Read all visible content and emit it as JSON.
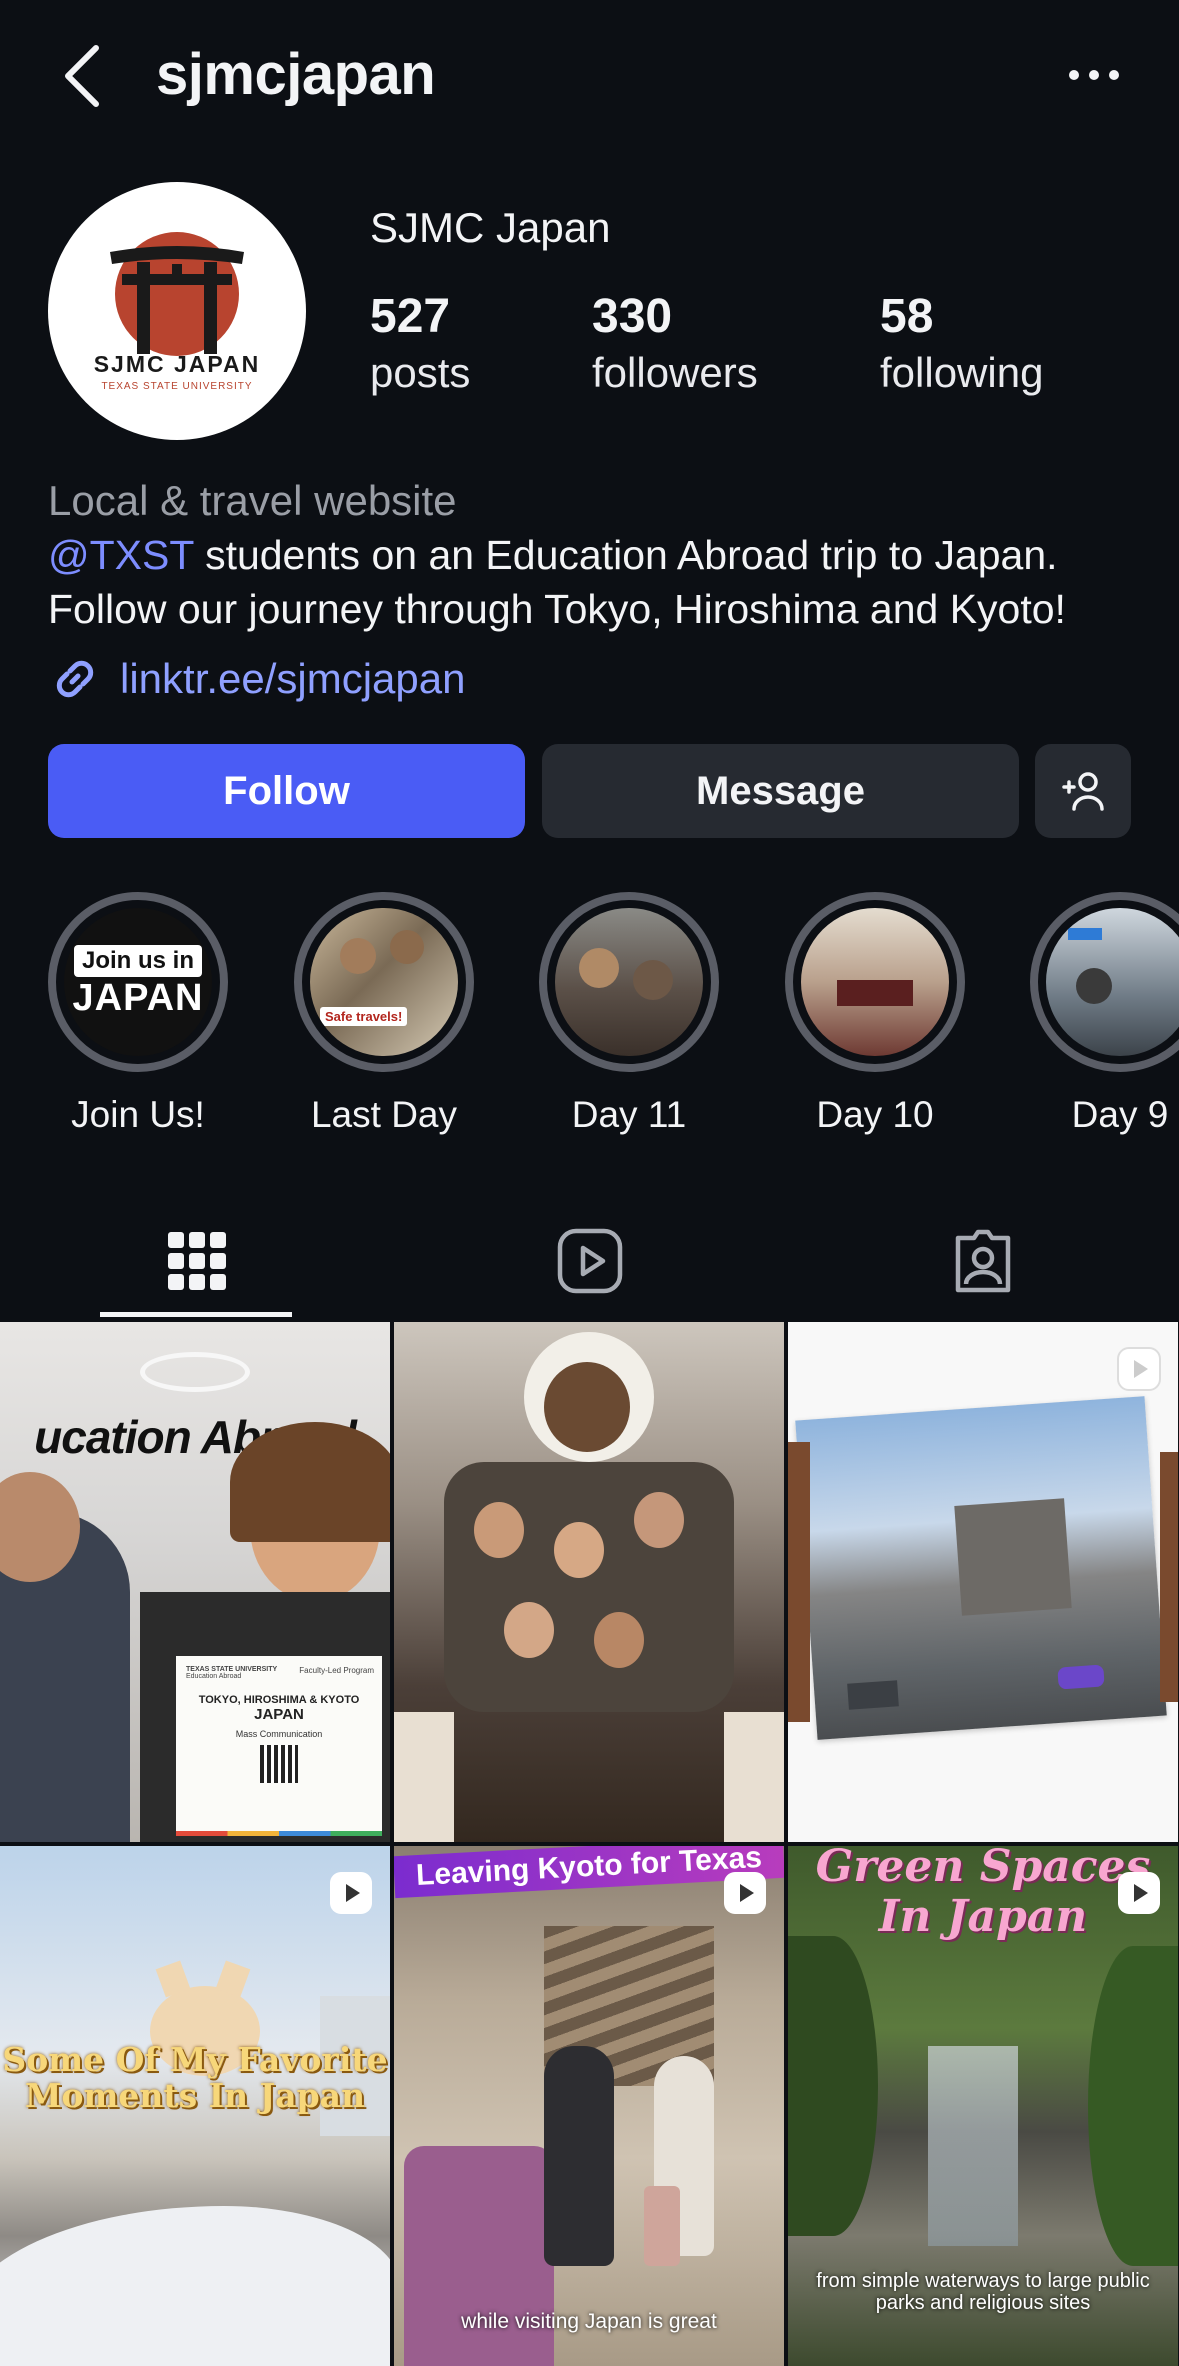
{
  "header": {
    "username": "sjmcjapan",
    "back_icon": "chevron-left-icon",
    "more_icon": "more-horizontal-icon"
  },
  "profile": {
    "display_name": "SJMC Japan",
    "avatar_text_main": "SJMC JAPAN",
    "avatar_text_sub": "TEXAS STATE UNIVERSITY",
    "stats": [
      {
        "value": "527",
        "label": "posts"
      },
      {
        "value": "330",
        "label": "followers"
      },
      {
        "value": "58",
        "label": "following"
      }
    ],
    "category": "Local & travel website",
    "bio_mention": "@TXST",
    "bio_text": " students on an Education Abroad trip to Japan. Follow our journey through Tokyo, Hiroshima and Kyoto!",
    "link": "linktr.ee/sjmcjapan"
  },
  "actions": {
    "follow_label": "Follow",
    "message_label": "Message",
    "add_user_icon": "add-user-icon"
  },
  "highlights": [
    {
      "label": "Join Us!",
      "pic_text_1": "Join us in",
      "pic_text_2": "JAPAN"
    },
    {
      "label": "Last Day",
      "pic_text_1": "Safe travels!"
    },
    {
      "label": "Day 11"
    },
    {
      "label": "Day 10"
    },
    {
      "label": "Day 9"
    }
  ],
  "tabs": [
    {
      "icon": "grid-icon",
      "active": true
    },
    {
      "icon": "reels-icon",
      "active": false
    },
    {
      "icon": "tagged-icon",
      "active": false
    }
  ],
  "posts": [
    {
      "overlay": "ucation Abroad",
      "sign_1": "Faculty-Led Program",
      "sign_2": "TOKYO, HIROSHIMA & KYOTO",
      "sign_3": "JAPAN",
      "sign_4": "Mass Communication",
      "sign_5": "TEXAS STATE UNIVERSITY",
      "sign_6": "Education Abroad",
      "reel": false
    },
    {
      "overlay": "",
      "reel": false
    },
    {
      "overlay": "",
      "reel": true
    },
    {
      "overlay": "Some Of My Favorite Moments In Japan",
      "reel": true
    },
    {
      "overlay": "Leaving Kyoto for Texas",
      "caption": "while visiting Japan is great",
      "reel": true
    },
    {
      "overlay": "Green Spaces In Japan",
      "caption": "from simple waterways to large public parks and religious sites",
      "reel": true
    }
  ],
  "colors": {
    "background": "#0c0f14",
    "follow_button": "#4a5cf5",
    "secondary_button": "#262a31",
    "link": "#8fa0ff",
    "torii_red": "#b8442f"
  }
}
